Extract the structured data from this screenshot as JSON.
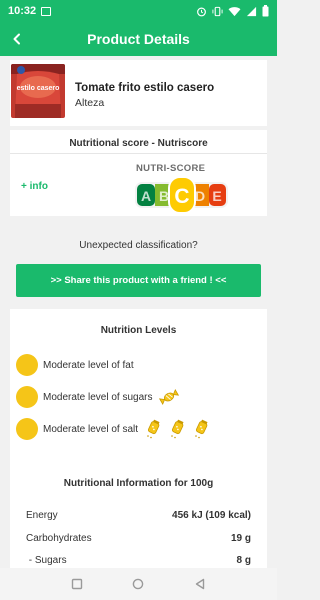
{
  "status_bar": {
    "time": "10:32"
  },
  "app_bar": {
    "title": "Product Details"
  },
  "product": {
    "name": "Tomate frito estilo casero",
    "brand": "Alteza",
    "image_text": "estilo casero"
  },
  "nutriscore": {
    "header": "Nutritional score - Nutriscore",
    "more_info": "+ info",
    "label": "NUTRI-SCORE",
    "grades": [
      "A",
      "B",
      "C",
      "D",
      "E"
    ],
    "selected": "C",
    "colors": [
      "#038141",
      "#85bb2f",
      "#fecb02",
      "#ee8100",
      "#e63e11"
    ]
  },
  "unexpected": "Unexpected classification?",
  "share_button": ">> Share this product with a friend ! <<",
  "nutrition_levels": {
    "header": "Nutrition Levels",
    "items": [
      {
        "text": "Moderate level of fat",
        "icon": ""
      },
      {
        "text": "Moderate level of sugars",
        "icon": "candy-icon"
      },
      {
        "text": "Moderate level of salt",
        "icon": "salt-shaker-icon"
      }
    ]
  },
  "nutrition_info": {
    "header": "Nutritional Information for 100g",
    "rows": [
      {
        "label": "Energy",
        "value": "456 kJ (109 kcal)"
      },
      {
        "label": "Carbohydrates",
        "value": "19 g"
      },
      {
        "label": " - Sugars",
        "value": "8 g"
      }
    ]
  },
  "accent_color": "#1aba6c",
  "level_color": "#f5c518"
}
